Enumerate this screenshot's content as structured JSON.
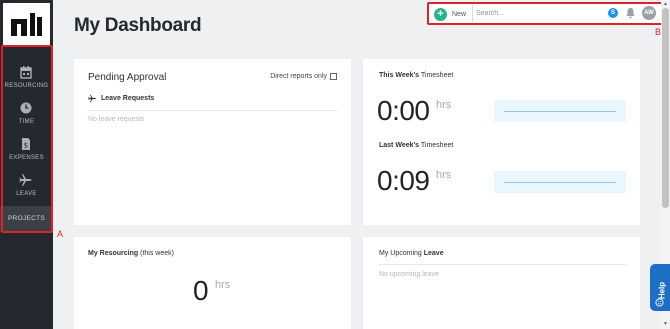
{
  "header": {
    "title": "My Dashboard",
    "new_label": "New",
    "search_placeholder": "Search...",
    "search_badge": "S",
    "avatar_initials": "AW"
  },
  "sidebar": {
    "items": [
      {
        "label": "RESOURCING",
        "icon": "calendar-icon"
      },
      {
        "label": "TIME",
        "icon": "clock-icon"
      },
      {
        "label": "EXPENSES",
        "icon": "receipt-icon"
      },
      {
        "label": "LEAVE",
        "icon": "plane-icon"
      }
    ],
    "projects_label": "PROJECTS"
  },
  "pending_approval": {
    "title": "Pending Approval",
    "direct_reports_label": "Direct reports only",
    "leave_requests_label": "Leave Requests",
    "empty_text": "No leave requests"
  },
  "timesheet": {
    "this_week_bold": "This Week's",
    "this_week_rest": " Timesheet",
    "this_week_value": "0:00",
    "last_week_bold": "Last Week's",
    "last_week_rest": " Timesheet",
    "last_week_value": "0:09",
    "unit": "hrs"
  },
  "resourcing": {
    "title_bold": "My Resourcing",
    "title_rest": " (this week)",
    "value": "0",
    "unit": "hrs"
  },
  "upcoming_leave": {
    "title_prefix": "My Upcoming ",
    "title_bold": "Leave",
    "empty_text": "No upcoming leave"
  },
  "help": {
    "label": "Help"
  },
  "annotations": {
    "a": "A",
    "b": "B"
  },
  "colors": {
    "sidebar_bg": "#23292e",
    "accent_green": "#29b58a",
    "annotation_red": "#e0212b",
    "help_blue": "#1c6fc4"
  }
}
